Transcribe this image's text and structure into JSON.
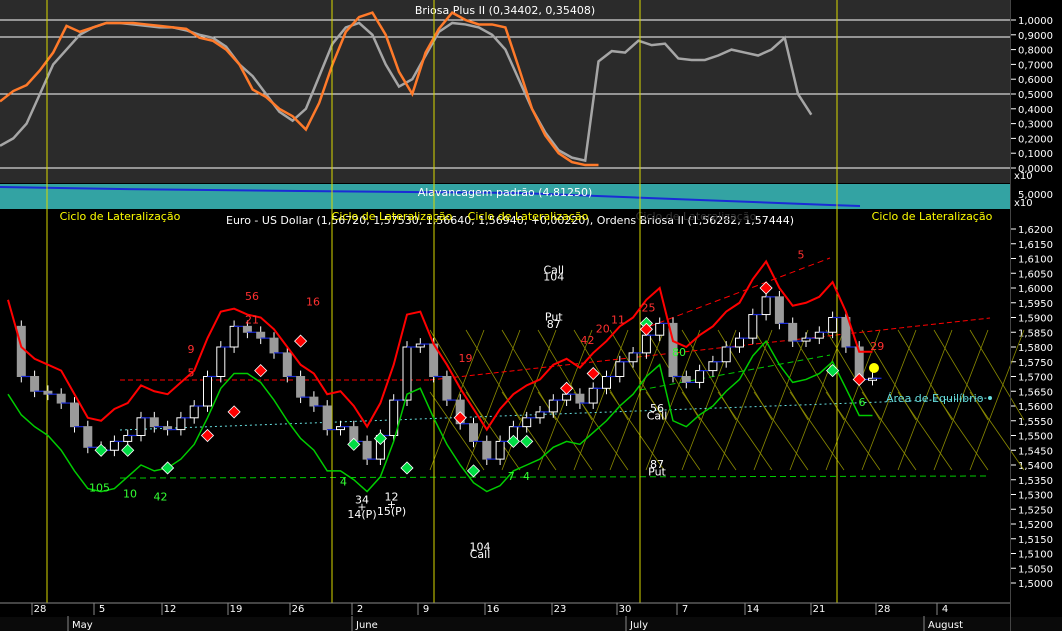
{
  "colors": {
    "bg": "#000000",
    "osc_bg": "#2b2b2b",
    "band_bg": "#33a3a3",
    "grid": "#ffffff",
    "cycle_line": "#d8d800",
    "orange": "#ff7a2a",
    "gray": "#a6a6a6",
    "red": "#ff0000",
    "green": "#00cc00",
    "yellow_text": "#ffff00",
    "blue": "#1a2bd6",
    "cyan": "#66dddd"
  },
  "oscillator": {
    "title": "Briosa Plus II (0,34402, 0,35408)",
    "ticks": [
      "1,0000",
      "0,9000",
      "0,8000",
      "0,7000",
      "0,6000",
      "0,5000",
      "0,4000",
      "0,3000",
      "0,2000",
      "0,1000",
      "0,0000"
    ],
    "multiplier": "x10",
    "ylim": [
      0,
      1.05
    ]
  },
  "band": {
    "title": "Alavancagem padrão (4,81250)",
    "tick": "5,0000",
    "multiplier": "x10"
  },
  "main": {
    "title": "Euro - US Dollar (1,56720, 1,57530, 1,56640, 1,56940, +0,00220), Ordens Briosa II (1,56282, 1,57444)",
    "ticks": [
      "1,6200",
      "1,6150",
      "1,6100",
      "1,6050",
      "1,6000",
      "1,5950",
      "1,5900",
      "1,5850",
      "1,5800",
      "1,5750",
      "1,5700",
      "1,5650",
      "1,5600",
      "1,5550",
      "1,5500",
      "1,5450",
      "1,5400",
      "1,5350",
      "1,5300",
      "1,5250",
      "1,5200",
      "1,5150",
      "1,5100",
      "1,5050",
      "1,5000"
    ],
    "ylim": [
      1.5,
      1.625
    ],
    "cycle_labels": [
      "Ciclo de Lateralização",
      "Ciclo de Lateralização",
      "Ciclo de Lateralização",
      "Ciclo de Lateralização",
      "Ciclo de Lateralização"
    ],
    "equilibrium_label": "Área de Equilíbrio"
  },
  "xaxis": {
    "day_labels": [
      "28",
      "5",
      "12",
      "19",
      "26",
      "2",
      "9",
      "16",
      "23",
      "30",
      "7",
      "14",
      "21",
      "28",
      "4"
    ],
    "month_labels": [
      "May",
      "June",
      "July",
      "August"
    ]
  },
  "chart_data": [
    {
      "type": "line",
      "title": "Briosa Plus II (0,34402, 0,35408)",
      "ylim": [
        0,
        1.05
      ],
      "series": [
        {
          "name": "Briosa Plus II (0,34402)",
          "values": [
            0.45,
            0.52,
            0.56,
            0.66,
            0.78,
            0.96,
            0.92,
            0.95,
            0.98,
            0.98,
            0.98,
            0.97,
            0.96,
            0.95,
            0.94,
            0.88,
            0.86,
            0.8,
            0.7,
            0.53,
            0.48,
            0.4,
            0.35,
            0.26,
            0.44,
            0.7,
            0.92,
            1.02,
            1.05,
            0.9,
            0.65,
            0.5,
            0.78,
            0.94,
            1.05,
            1.0,
            0.97,
            0.97,
            0.95,
            0.68,
            0.4,
            0.22,
            0.1,
            0.04,
            0.02,
            0.02
          ]
        },
        {
          "name": "Briosa Plus II (0,35408)",
          "values": [
            0.15,
            0.2,
            0.3,
            0.5,
            0.7,
            0.8,
            0.9,
            0.95,
            0.98,
            0.98,
            0.97,
            0.96,
            0.95,
            0.95,
            0.93,
            0.9,
            0.88,
            0.82,
            0.7,
            0.62,
            0.5,
            0.38,
            0.32,
            0.4,
            0.62,
            0.84,
            0.95,
            0.98,
            0.9,
            0.7,
            0.55,
            0.6,
            0.76,
            0.92,
            0.98,
            0.97,
            0.95,
            0.9,
            0.8,
            0.6,
            0.4,
            0.24,
            0.12,
            0.07,
            0.05,
            0.72,
            0.79,
            0.78,
            0.86,
            0.83,
            0.84,
            0.74,
            0.73,
            0.73,
            0.76,
            0.8,
            0.78,
            0.76,
            0.8,
            0.88,
            0.5,
            0.36
          ]
        }
      ]
    },
    {
      "type": "bar",
      "title": "Alavancagem padrão (4,81250)",
      "series": [
        {
          "name": "Alavancagem padrão",
          "values": [
            4.8125
          ]
        }
      ]
    },
    {
      "type": "line",
      "title": "Euro - US Dollar (1,56720, 1,57530, 1,56640, 1,56940, +0,00220), Ordens Briosa II (1,56282, 1,57444)",
      "ylim": [
        1.5,
        1.625
      ],
      "series": [
        {
          "name": "Euro - US Dollar",
          "values": [
            1.587,
            1.57,
            1.565,
            1.564,
            1.561,
            1.553,
            1.546,
            1.545,
            1.548,
            1.55,
            1.556,
            1.553,
            1.552,
            1.556,
            1.56,
            1.57,
            1.58,
            1.587,
            1.585,
            1.583,
            1.578,
            1.57,
            1.563,
            1.56,
            1.552,
            1.553,
            1.548,
            1.542,
            1.55,
            1.562,
            1.58,
            1.581,
            1.57,
            1.562,
            1.554,
            1.548,
            1.542,
            1.548,
            1.553,
            1.556,
            1.558,
            1.562,
            1.564,
            1.561,
            1.566,
            1.57,
            1.575,
            1.578,
            1.584,
            1.588,
            1.57,
            1.568,
            1.572,
            1.575,
            1.58,
            1.583,
            1.591,
            1.597,
            1.588,
            1.582,
            1.583,
            1.585,
            1.59,
            1.58,
            1.569,
            1.5694
          ]
        },
        {
          "name": "Ordens Briosa II (1,56282)",
          "values": [
            1.57,
            1.563,
            1.559,
            1.556,
            1.551,
            1.544,
            1.538,
            1.537,
            1.538,
            1.542,
            1.546,
            1.544,
            1.545,
            1.548,
            1.553,
            1.562,
            1.572,
            1.577,
            1.577,
            1.574,
            1.568,
            1.561,
            1.555,
            1.551,
            1.544,
            1.544,
            1.541,
            1.537,
            1.542,
            1.554,
            1.57,
            1.572,
            1.562,
            1.553,
            1.546,
            1.54,
            1.537,
            1.539,
            1.544,
            1.546,
            1.548,
            1.552,
            1.554,
            1.553,
            1.557,
            1.561,
            1.566,
            1.57,
            1.576,
            1.58,
            1.561,
            1.559,
            1.563,
            1.566,
            1.571,
            1.575,
            1.583,
            1.588,
            1.58,
            1.574,
            1.575,
            1.577,
            1.581,
            1.572,
            1.5628,
            1.5628
          ]
        },
        {
          "name": "Ordens Briosa II (1,57444)",
          "values": [
            1.592,
            1.576,
            1.572,
            1.57,
            1.568,
            1.56,
            1.552,
            1.551,
            1.555,
            1.557,
            1.563,
            1.561,
            1.56,
            1.564,
            1.568,
            1.579,
            1.588,
            1.589,
            1.587,
            1.586,
            1.582,
            1.576,
            1.57,
            1.567,
            1.56,
            1.561,
            1.556,
            1.549,
            1.557,
            1.57,
            1.587,
            1.588,
            1.577,
            1.57,
            1.562,
            1.555,
            1.548,
            1.555,
            1.56,
            1.563,
            1.565,
            1.57,
            1.572,
            1.569,
            1.574,
            1.578,
            1.583,
            1.586,
            1.592,
            1.596,
            1.578,
            1.576,
            1.58,
            1.583,
            1.588,
            1.591,
            1.599,
            1.605,
            1.596,
            1.59,
            1.591,
            1.593,
            1.598,
            1.588,
            1.5744,
            1.5744
          ]
        }
      ]
    }
  ],
  "annotations": {
    "red": [
      {
        "text": "56",
        "day": 8,
        "price": 1.596
      },
      {
        "text": "21",
        "day": 8,
        "price": 1.588
      },
      {
        "text": "9",
        "day": 6,
        "price": 1.578
      },
      {
        "text": "5",
        "day": 6,
        "price": 1.57
      },
      {
        "text": "16",
        "day": 10,
        "price": 1.594
      },
      {
        "text": "19",
        "day": 15,
        "price": 1.575
      },
      {
        "text": "42",
        "day": 19,
        "price": 1.581
      },
      {
        "text": "20",
        "day": 19.5,
        "price": 1.585
      },
      {
        "text": "11",
        "day": 20,
        "price": 1.588
      },
      {
        "text": "25",
        "day": 21,
        "price": 1.592
      },
      {
        "text": "5",
        "day": 26,
        "price": 1.61
      },
      {
        "text": "29",
        "day": 28.5,
        "price": 1.579
      }
    ],
    "green": [
      {
        "text": "105",
        "day": 3,
        "price": 1.531
      },
      {
        "text": "10",
        "day": 4,
        "price": 1.529
      },
      {
        "text": "42",
        "day": 5,
        "price": 1.528
      },
      {
        "text": "4",
        "day": 11,
        "price": 1.533
      },
      {
        "text": "7",
        "day": 16.5,
        "price": 1.535
      },
      {
        "text": "4",
        "day": 17,
        "price": 1.535
      },
      {
        "text": "80",
        "day": 22,
        "price": 1.577
      },
      {
        "text": "6",
        "day": 28,
        "price": 1.56
      }
    ],
    "white": [
      {
        "text": "Call",
        "day": 18.5,
        "price": 1.605
      },
      {
        "text": "104",
        "day": 18.5,
        "price": 1.6025
      },
      {
        "text": "Put",
        "day": 18.5,
        "price": 1.589
      },
      {
        "text": "87",
        "day": 18.5,
        "price": 1.5865
      },
      {
        "text": "34",
        "day": 12,
        "price": 1.527
      },
      {
        "text": "+",
        "day": 12,
        "price": 1.5245
      },
      {
        "text": "14(P)",
        "day": 12,
        "price": 1.522
      },
      {
        "text": "12",
        "day": 13,
        "price": 1.528
      },
      {
        "text": "+",
        "day": 13,
        "price": 1.5255
      },
      {
        "text": "15(P)",
        "day": 13,
        "price": 1.523
      },
      {
        "text": "104",
        "day": 16,
        "price": 1.511
      },
      {
        "text": "Call",
        "day": 16,
        "price": 1.5085
      },
      {
        "text": "56",
        "day": 22,
        "price": 1.558
      },
      {
        "text": "Call",
        "day": 22,
        "price": 1.5555
      },
      {
        "text": "87",
        "day": 22,
        "price": 1.539
      },
      {
        "text": "Put",
        "day": 22,
        "price": 1.5365
      }
    ]
  }
}
